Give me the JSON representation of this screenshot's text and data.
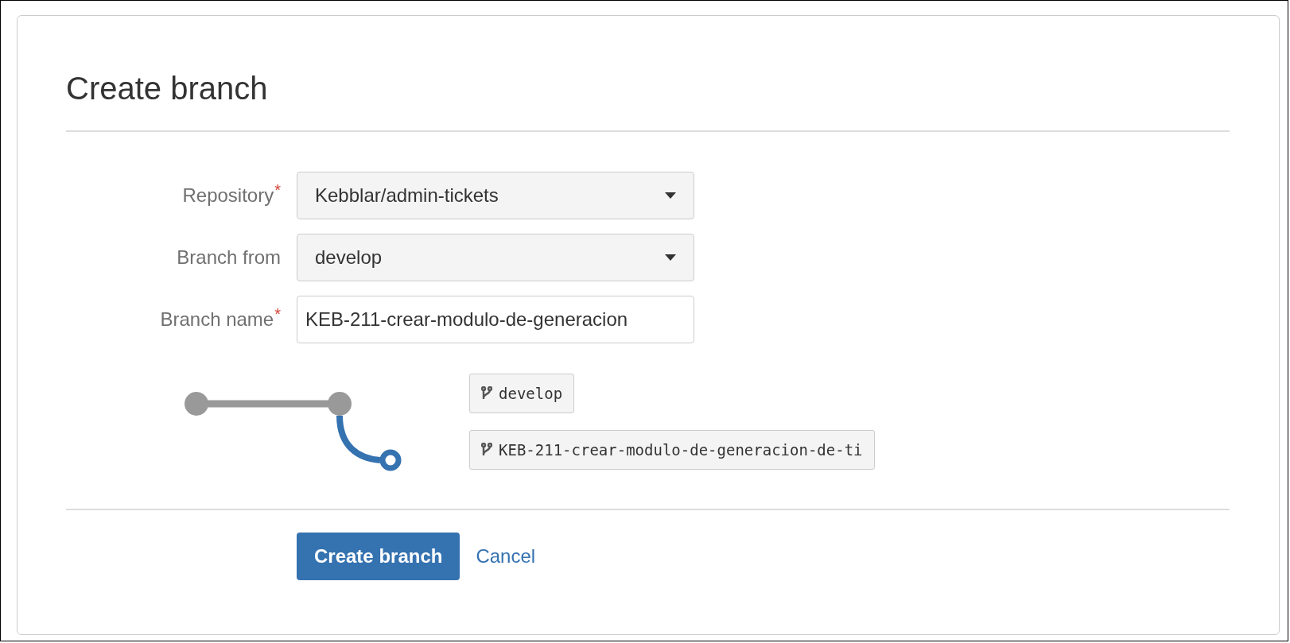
{
  "dialog": {
    "title": "Create branch"
  },
  "fields": [
    {
      "kind": "select",
      "label": "Repository",
      "required_mark": "*",
      "value": "Kebblar/admin-tickets"
    },
    {
      "kind": "select",
      "label": "Branch from",
      "value": "develop"
    },
    {
      "kind": "input",
      "label": "Branch name",
      "required_mark": "*",
      "value": "KEB-211-crear-modulo-de-generacion"
    }
  ],
  "preview": {
    "branches": [
      {
        "name": "develop"
      },
      {
        "name": "KEB-211-crear-modulo-de-generacion-de-ti"
      }
    ]
  },
  "buttons": [
    {
      "kind": "primary",
      "label": "Create branch"
    },
    {
      "kind": "link",
      "label": "Cancel"
    }
  ]
}
